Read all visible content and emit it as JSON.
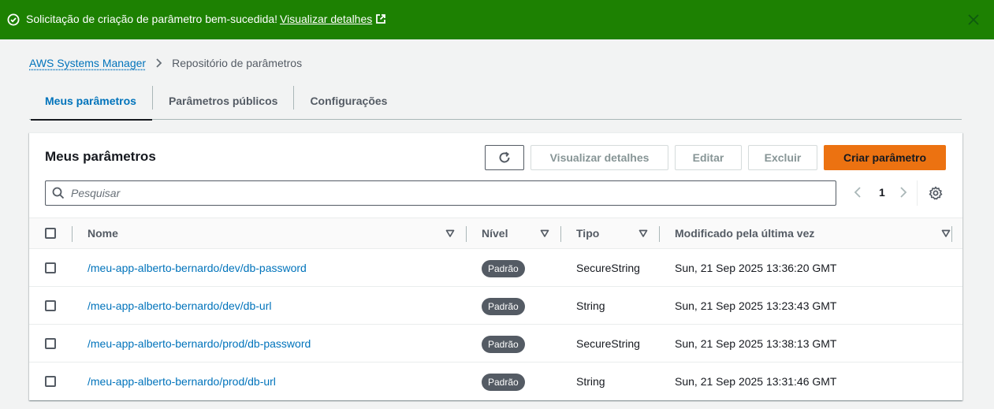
{
  "flash": {
    "message": "Solicitação de criação de parâmetro bem-sucedida!",
    "link_label": "Visualizar detalhes"
  },
  "breadcrumb": {
    "home": "AWS Systems Manager",
    "current": "Repositório de parâmetros"
  },
  "tabs": [
    {
      "label": "Meus parâmetros",
      "active": true
    },
    {
      "label": "Parâmetros públicos",
      "active": false
    },
    {
      "label": "Configurações",
      "active": false
    }
  ],
  "panel": {
    "title": "Meus parâmetros",
    "buttons": {
      "view_details": "Visualizar detalhes",
      "edit": "Editar",
      "delete": "Excluir",
      "create": "Criar parâmetro"
    },
    "search_placeholder": "Pesquisar",
    "current_page": "1"
  },
  "table": {
    "columns": [
      "Nome",
      "Nível",
      "Tipo",
      "Modificado pela última vez"
    ],
    "rows": [
      {
        "name": "/meu-app-alberto-bernardo/dev/db-password",
        "tier": "Padrão",
        "type": "SecureString",
        "modified": "Sun, 21 Sep 2025 13:36:20 GMT"
      },
      {
        "name": "/meu-app-alberto-bernardo/dev/db-url",
        "tier": "Padrão",
        "type": "String",
        "modified": "Sun, 21 Sep 2025 13:23:43 GMT"
      },
      {
        "name": "/meu-app-alberto-bernardo/prod/db-password",
        "tier": "Padrão",
        "type": "SecureString",
        "modified": "Sun, 21 Sep 2025 13:38:13 GMT"
      },
      {
        "name": "/meu-app-alberto-bernardo/prod/db-url",
        "tier": "Padrão",
        "type": "String",
        "modified": "Sun, 21 Sep 2025 13:31:46 GMT"
      }
    ]
  },
  "colors": {
    "success": "#1d8102",
    "link": "#0073bb",
    "primary": "#ec7211",
    "badge": "#545b64"
  }
}
